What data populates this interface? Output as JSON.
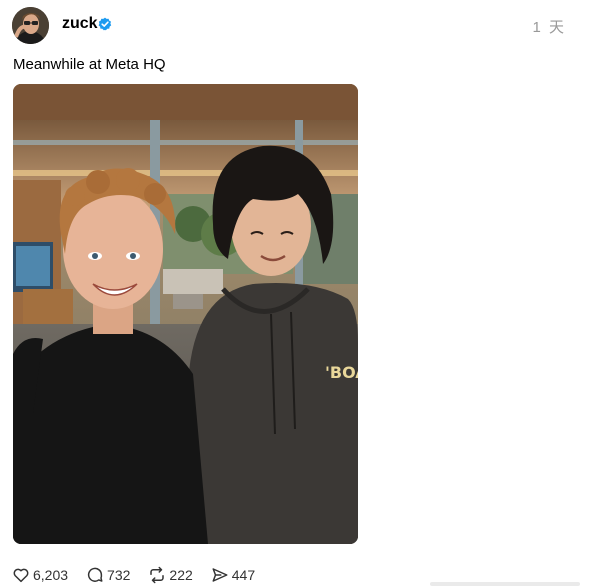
{
  "post": {
    "author": {
      "username": "zuck",
      "verified": true,
      "verified_color": "#1d9bf0",
      "avatar_icon": "avatar-photo"
    },
    "timestamp": "1 天",
    "caption": "Meanwhile at Meta HQ",
    "image": {
      "hoodie_text": "'BOA"
    },
    "stats": {
      "likes": "6,203",
      "replies": "732",
      "reposts": "222",
      "shares": "447"
    }
  },
  "icons": {
    "like": "heart-icon",
    "reply": "comment-icon",
    "repost": "repost-icon",
    "share": "send-icon",
    "verified": "verified-badge-icon"
  }
}
